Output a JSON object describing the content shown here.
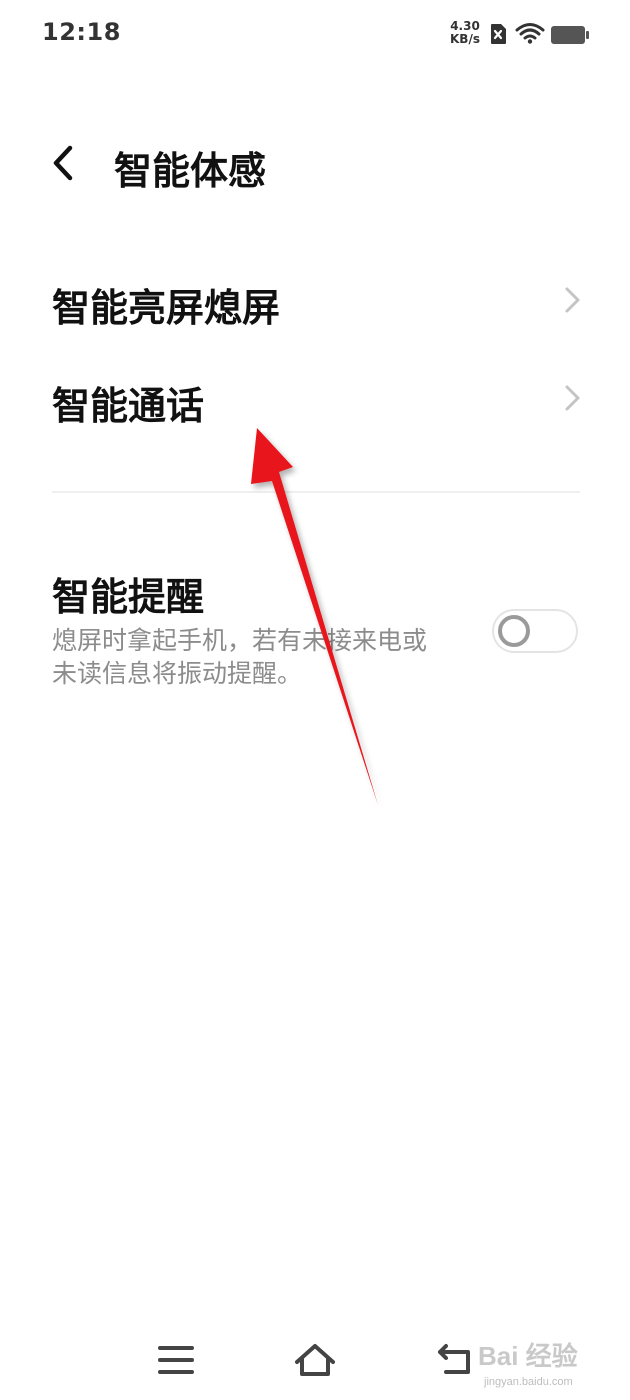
{
  "status_bar": {
    "time": "12:18",
    "net_speed_value": "4.30",
    "net_speed_unit": "KB/s",
    "icons": [
      "sim-off-icon",
      "wifi-icon",
      "battery-icon"
    ]
  },
  "header": {
    "title": "智能体感",
    "back_icon": "back-chevron-icon"
  },
  "menu": {
    "items": [
      {
        "label": "智能亮屏熄屏",
        "icon": "chevron-right-icon"
      },
      {
        "label": "智能通话",
        "icon": "chevron-right-icon"
      }
    ]
  },
  "reminder": {
    "title": "智能提醒",
    "description": "熄屏时拿起手机，若有未接来电或未读信息将振动提醒。",
    "toggle_on": false
  },
  "nav_bar": {
    "icons": [
      "menu-icon",
      "home-icon",
      "back-icon"
    ]
  },
  "watermark": {
    "text": "Bai 经验",
    "subtext": "jingyan.baidu.com"
  },
  "colors": {
    "arrow": "#e8161c",
    "text_primary": "#111111",
    "text_secondary": "#8c8c8c",
    "divider": "#efefef"
  }
}
